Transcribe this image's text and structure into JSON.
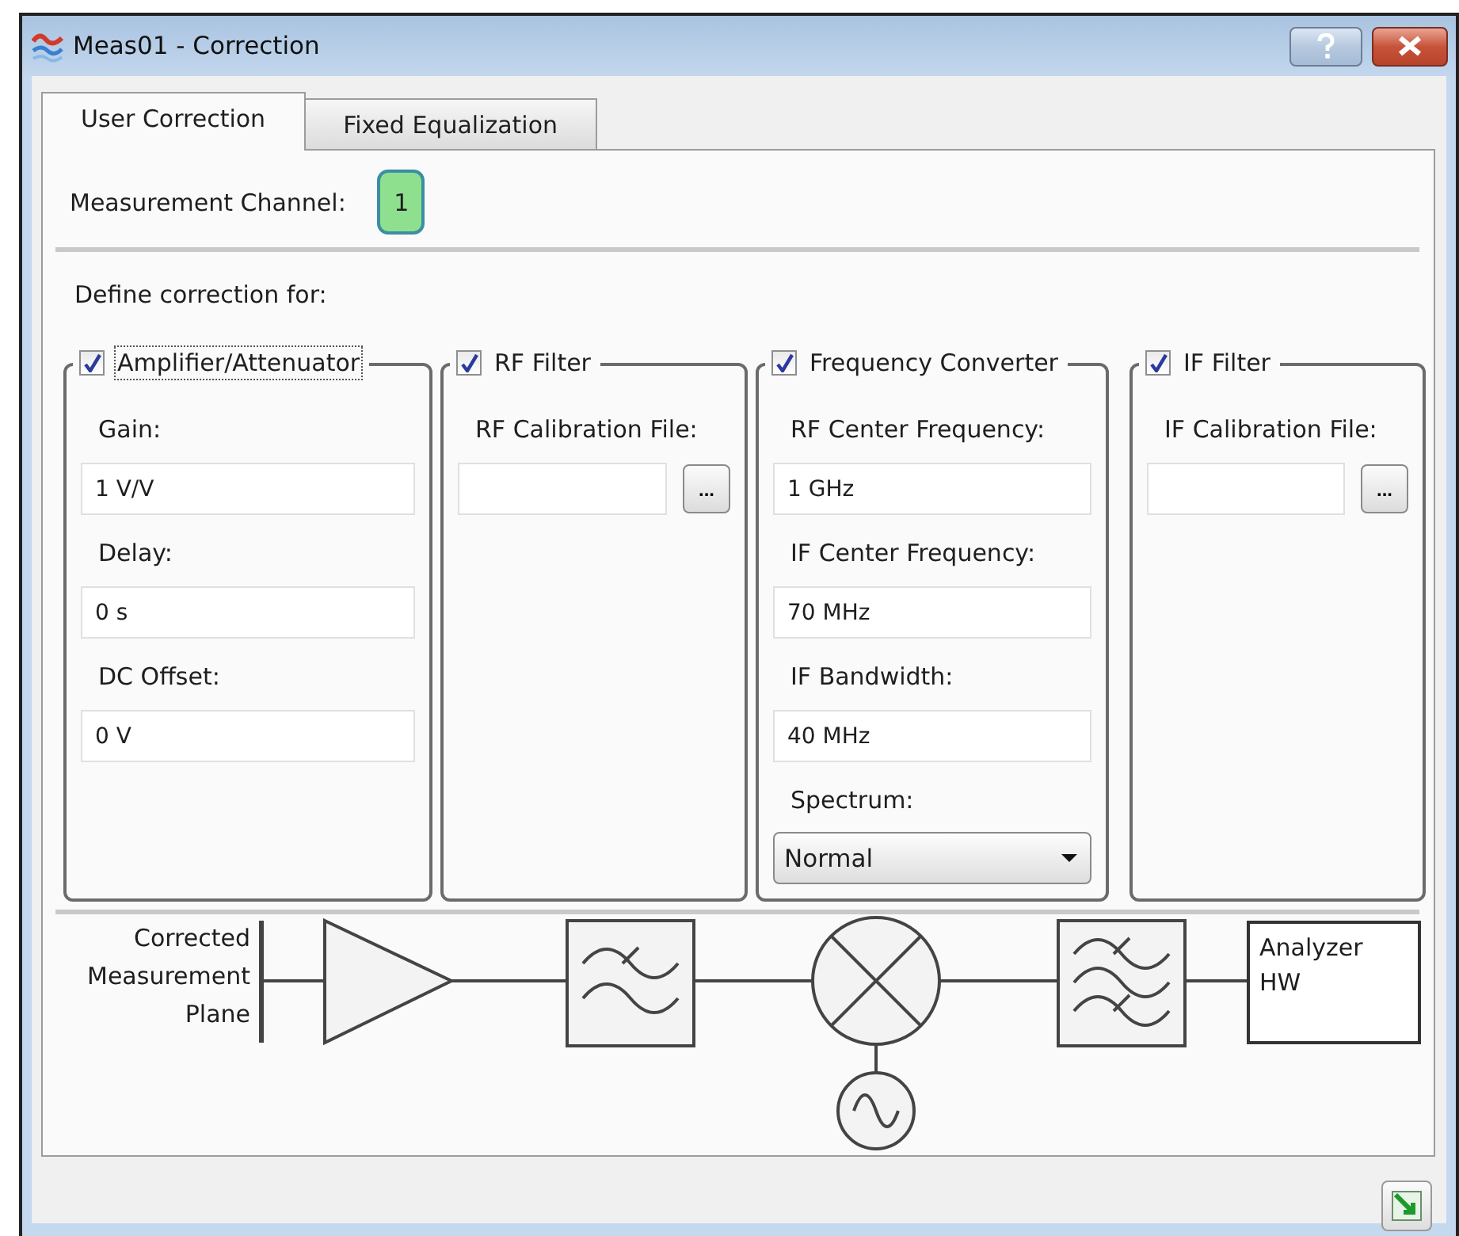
{
  "window": {
    "title": "Meas01 - Correction"
  },
  "tabs": [
    {
      "label": "User Correction",
      "selected": true
    },
    {
      "label": "Fixed Equalization",
      "selected": false
    }
  ],
  "channel": {
    "label": "Measurement Channel:",
    "value": "1"
  },
  "define_label": "Define correction for:",
  "groups": [
    {
      "title": "Amplifier/Attenuator",
      "checked": true,
      "focused": true,
      "fields": [
        {
          "kind": "text",
          "label": "Gain:",
          "value": "1 V/V"
        },
        {
          "kind": "text",
          "label": "Delay:",
          "value": "0 s"
        },
        {
          "kind": "text",
          "label": "DC Offset:",
          "value": "0 V"
        }
      ]
    },
    {
      "title": "RF Filter",
      "checked": true,
      "focused": false,
      "fields": [
        {
          "kind": "file",
          "label": "RF Calibration File:",
          "browse": "..."
        }
      ]
    },
    {
      "title": "Frequency Converter",
      "checked": true,
      "focused": false,
      "fields": [
        {
          "kind": "text",
          "label": "RF Center Frequency:",
          "value": "1 GHz"
        },
        {
          "kind": "text",
          "label": "IF Center Frequency:",
          "value": "70 MHz"
        },
        {
          "kind": "text",
          "label": "IF Bandwidth:",
          "value": "40 MHz"
        },
        {
          "kind": "select",
          "label": "Spectrum:",
          "value": "Normal"
        }
      ]
    },
    {
      "title": "IF Filter",
      "checked": true,
      "focused": false,
      "fields": [
        {
          "kind": "file",
          "label": "IF Calibration File:",
          "browse": "..."
        }
      ]
    }
  ],
  "diagram": {
    "plane_label": "Corrected Measurement Plane",
    "output_label": "Analyzer HW"
  }
}
